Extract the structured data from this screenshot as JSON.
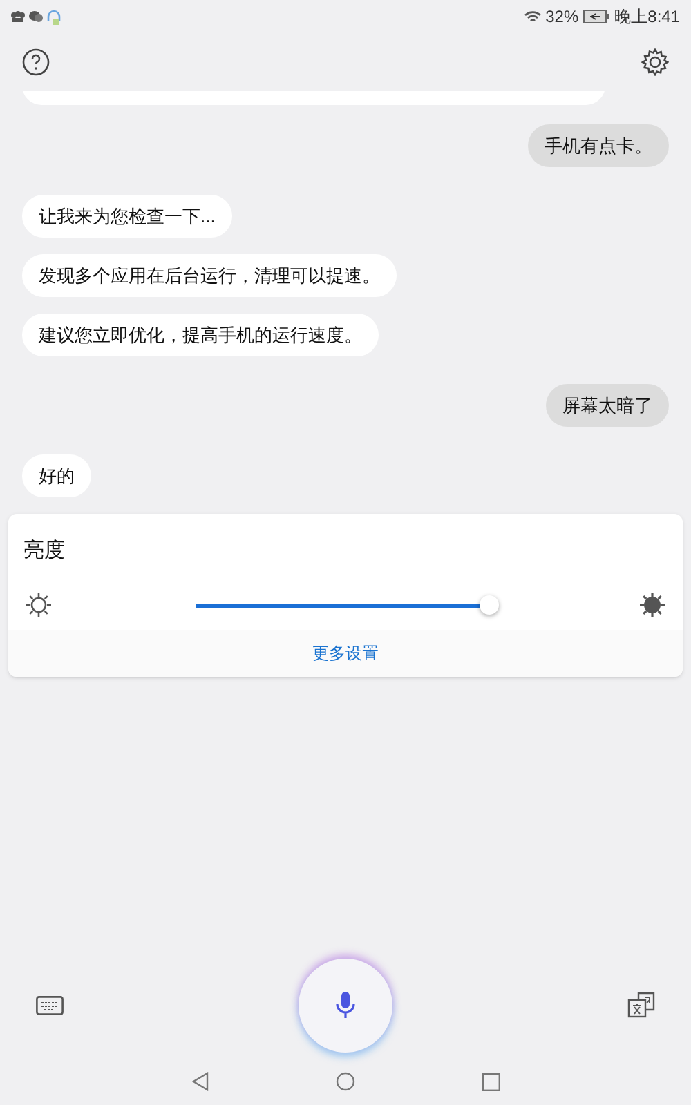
{
  "status_bar": {
    "battery_percent": "32%",
    "time": "晚上8:41"
  },
  "messages": [
    {
      "kind": "user",
      "text": "手机有点卡。"
    },
    {
      "kind": "assistant",
      "text": "让我来为您检查一下..."
    },
    {
      "kind": "assistant",
      "text": "发现多个应用在后台运行，清理可以提速。"
    },
    {
      "kind": "assistant",
      "text": "建议您立即优化，提高手机的运行速度。"
    },
    {
      "kind": "user",
      "text": "屏幕太暗了"
    },
    {
      "kind": "assistant",
      "text": "好的"
    }
  ],
  "brightness_card": {
    "title": "亮度",
    "level": 0.98,
    "more_link": "更多设置"
  }
}
